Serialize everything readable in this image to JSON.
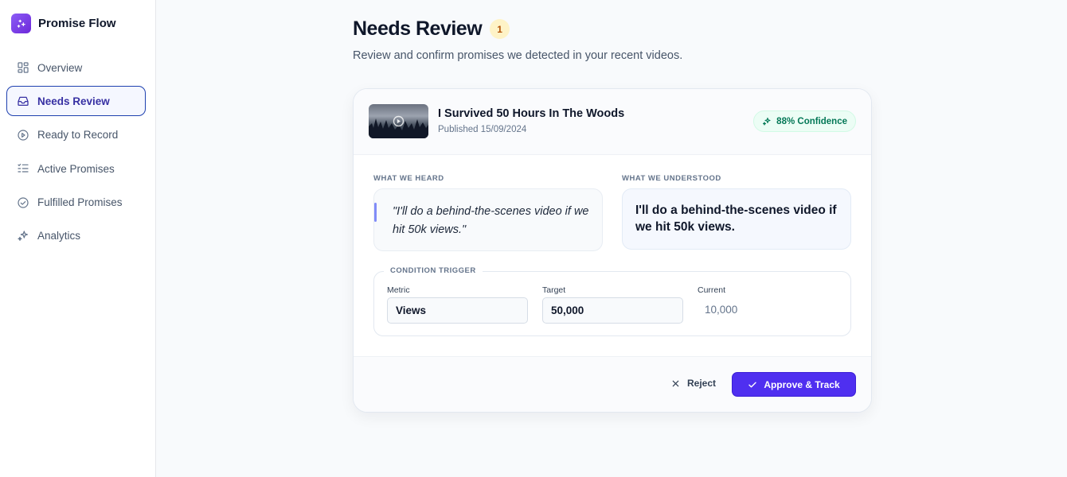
{
  "app": {
    "name": "Promise Flow"
  },
  "sidebar": {
    "items": [
      {
        "label": "Overview",
        "icon": "grid-icon",
        "active": false
      },
      {
        "label": "Needs Review",
        "icon": "inbox-icon",
        "active": true
      },
      {
        "label": "Ready to Record",
        "icon": "play-circle-icon",
        "active": false
      },
      {
        "label": "Active Promises",
        "icon": "list-check-icon",
        "active": false
      },
      {
        "label": "Fulfilled Promises",
        "icon": "check-circle-icon",
        "active": false
      },
      {
        "label": "Analytics",
        "icon": "sparkles-icon",
        "active": false
      }
    ]
  },
  "header": {
    "title": "Needs Review",
    "count": "1",
    "subtitle": "Review and confirm promises we detected in your recent videos."
  },
  "card": {
    "video_title": "I Survived 50 Hours In The Woods",
    "published": "Published 15/09/2024",
    "confidence": "88% Confidence",
    "heard_label": "WHAT WE HEARD",
    "heard_text": "\"I'll do a behind-the-scenes video if we hit 50k views.\"",
    "understood_label": "WHAT WE UNDERSTOOD",
    "understood_text": "I'll do a behind-the-scenes video if we hit 50k views.",
    "condition": {
      "label": "CONDITION TRIGGER",
      "metric_label": "Metric",
      "metric_value": "Views",
      "target_label": "Target",
      "target_value": "50,000",
      "current_label": "Current",
      "current_value": "10,000"
    },
    "actions": {
      "reject": "Reject",
      "approve": "Approve & Track"
    }
  },
  "colors": {
    "accent": "#4f2ff0",
    "active_nav_border": "#1e40af",
    "badge_bg": "#fef3c7",
    "confidence_text": "#047857"
  }
}
